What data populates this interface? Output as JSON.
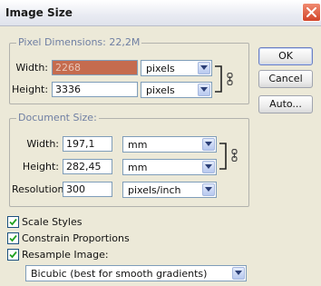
{
  "dialog": {
    "title": "Image Size",
    "close_icon": "close-icon"
  },
  "pixel_dimensions": {
    "title": "Pixel Dimensions:  22,2M",
    "width_label": "Width:",
    "width_value": "2268",
    "width_unit": "pixels",
    "height_label": "Height:",
    "height_value": "3336",
    "height_unit": "pixels"
  },
  "document_size": {
    "title": "Document Size:",
    "width_label": "Width:",
    "width_value": "197,1",
    "width_unit": "mm",
    "height_label": "Height:",
    "height_value": "282,45",
    "height_unit": "mm",
    "resolution_label": "Resolution:",
    "resolution_value": "300",
    "resolution_unit": "pixels/inch"
  },
  "buttons": {
    "ok": "OK",
    "cancel": "Cancel",
    "auto": "Auto..."
  },
  "options": {
    "scale_styles": {
      "label": "Scale Styles",
      "checked": true
    },
    "constrain_proportions": {
      "label": "Constrain Proportions",
      "checked": true
    },
    "resample_image": {
      "label": "Resample Image:",
      "checked": true
    },
    "resample_method": "Bicubic (best for smooth gradients)"
  },
  "colors": {
    "dialog_bg": "#ece9d8",
    "group_title": "#6f7fa3",
    "selection": "#c56b4e",
    "close_button": "#d2452a"
  }
}
